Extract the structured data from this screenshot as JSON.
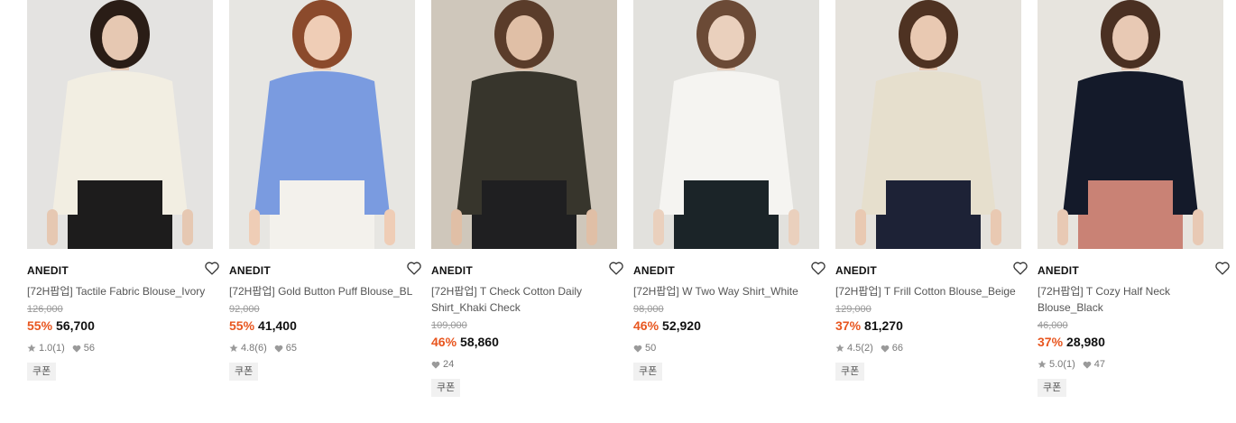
{
  "products": [
    {
      "brand": "ANEDIT",
      "title": "[72H팝업] Tactile Fabric Blouse_Ivory",
      "original_price": "126,000",
      "discount": "55%",
      "price": "56,700",
      "rating": "1.0",
      "reviews": "(1)",
      "likes": "56",
      "coupon": "쿠폰",
      "colors": {
        "bg": "#e4e3e1",
        "top": "#f2eee2",
        "bottom": "#1d1c1c",
        "hair": "#2a1d16",
        "skin": "#e6c8b2"
      }
    },
    {
      "brand": "ANEDIT",
      "title": "[72H팝업] Gold Button Puff Blouse_BL",
      "original_price": "92,000",
      "discount": "55%",
      "price": "41,400",
      "rating": "4.8",
      "reviews": "(6)",
      "likes": "65",
      "coupon": "쿠폰",
      "colors": {
        "bg": "#e7e6e2",
        "top": "#7a9be0",
        "bottom": "#f3f1ec",
        "hair": "#8b4a2c",
        "skin": "#efcdb6"
      }
    },
    {
      "brand": "ANEDIT",
      "title": "[72H팝업] T Check Cotton Daily Shirt_Khaki Check",
      "original_price": "109,000",
      "discount": "46%",
      "price": "58,860",
      "rating": "",
      "reviews": "",
      "likes": "24",
      "coupon": "쿠폰",
      "colors": {
        "bg": "#cfc7bb",
        "top": "#37352c",
        "bottom": "#1f1f21",
        "hair": "#5a3c2a",
        "skin": "#e0bfa6"
      }
    },
    {
      "brand": "ANEDIT",
      "title": "[72H팝업] W Two Way Shirt_White",
      "original_price": "98,000",
      "discount": "46%",
      "price": "52,920",
      "rating": "",
      "reviews": "",
      "likes": "50",
      "coupon": "쿠폰",
      "colors": {
        "bg": "#e2e1dd",
        "top": "#f5f4f1",
        "bottom": "#1b2428",
        "hair": "#6b4a36",
        "skin": "#ead0bd"
      }
    },
    {
      "brand": "ANEDIT",
      "title": "[72H팝업] T Frill Cotton Blouse_Beige",
      "original_price": "129,000",
      "discount": "37%",
      "price": "81,270",
      "rating": "4.5",
      "reviews": "(2)",
      "likes": "66",
      "coupon": "쿠폰",
      "colors": {
        "bg": "#e5e2dc",
        "top": "#e6dfcd",
        "bottom": "#1d2236",
        "hair": "#4e3222",
        "skin": "#e9c9b2"
      }
    },
    {
      "brand": "ANEDIT",
      "title": "[72H팝업] T Cozy Half Neck Blouse_Black",
      "original_price": "46,000",
      "discount": "37%",
      "price": "28,980",
      "rating": "5.0",
      "reviews": "(1)",
      "likes": "47",
      "coupon": "쿠폰",
      "colors": {
        "bg": "#e7e4de",
        "top": "#141a2a",
        "bottom": "#c98275",
        "hair": "#4a3022",
        "skin": "#e8c9b4"
      }
    }
  ]
}
